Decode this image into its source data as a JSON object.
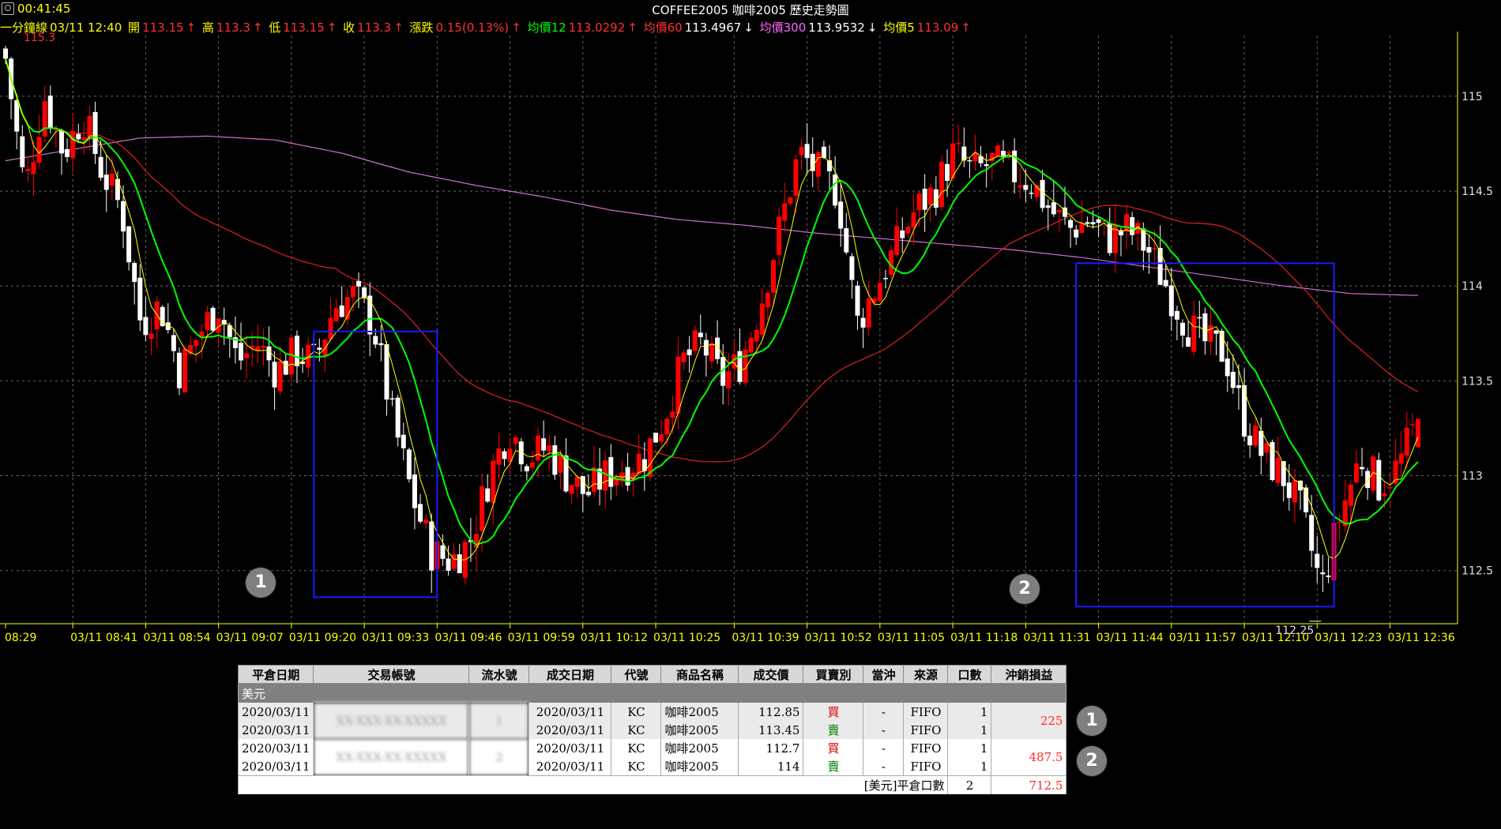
{
  "clock": "00:41:45",
  "title": "COFFEE2005 咖啡2005  歷史走勢圖",
  "info": {
    "label_1min": "一分鐘線",
    "date_time": "03/11 12:40",
    "open_label": "開",
    "open_value": "113.15",
    "high_label": "高",
    "high_value": "113.3",
    "low_label": "低",
    "low_value": "113.15",
    "close_label": "收",
    "close_value": "113.3",
    "change_label": "漲跌",
    "change_value": "0.15(0.13%)",
    "ma12_label": "均價12",
    "ma12_value": "113.0292",
    "ma60_label": "均價60",
    "ma60_value": "113.4967",
    "ma300_label": "均價300",
    "ma300_value": "113.9532",
    "ma5_label": "均價5",
    "ma5_value": "113.09",
    "up_arrow": "↑",
    "down_arrow": "↓",
    "top_price_label": "115.3"
  },
  "colors": {
    "up_candle": "#ff0000",
    "down_candle": "#ffffff",
    "ma5": "#ffff00",
    "ma12": "#00ff00",
    "ma60": "#e02020",
    "ma300": "#d070d0",
    "box": "#1a1aff",
    "grid": "#666666"
  },
  "chart_data": {
    "type": "candlestick",
    "title": "COFFEE2005 咖啡2005  歷史走勢圖",
    "y_ticks": [
      "115",
      "114.5",
      "114",
      "113.5",
      "113",
      "112.5"
    ],
    "x_ticks": [
      "08:29",
      "03/11 08:41",
      "03/11 08:54",
      "03/11 09:07",
      "03/11 09:20",
      "03/11 09:33",
      "03/11 09:46",
      "03/11 09:59",
      "03/11 10:12",
      "03/11 10:25",
      "03/11 10:39",
      "03/11 10:52",
      "03/11 11:05",
      "03/11 11:18",
      "03/11 11:31",
      "03/11 11:44",
      "03/11 11:57",
      "03/11 12:10",
      "03/11 12:23",
      "03/11 12:36"
    ],
    "ylim": [
      112.22,
      115.32
    ],
    "grid": true,
    "low_annotation": "112.25",
    "close_path": [
      115.2,
      114.5,
      115.0,
      114.7,
      114.9,
      114.6,
      114.4,
      113.8,
      113.9,
      113.55,
      113.75,
      113.9,
      113.6,
      113.7,
      113.55,
      113.65,
      113.6,
      113.9,
      113.95,
      113.8,
      113.3,
      112.9,
      112.6,
      112.55,
      112.65,
      113.0,
      113.25,
      113.1,
      113.15,
      113.0,
      112.9,
      113.0,
      113.05,
      113.1,
      113.3,
      113.6,
      113.7,
      113.5,
      113.6,
      113.9,
      114.3,
      114.7,
      114.6,
      114.5,
      113.8,
      114.0,
      114.2,
      114.4,
      114.5,
      114.7,
      114.6,
      114.65,
      114.6,
      114.55,
      114.4,
      114.3,
      114.35,
      114.25,
      114.3,
      114.2,
      114.0,
      113.8,
      113.7,
      113.65,
      113.3,
      113.1,
      113.0,
      112.8,
      112.4,
      112.8,
      113.1,
      112.95,
      113.05,
      113.3
    ],
    "ma300_path": [
      114.66,
      114.72,
      114.78,
      114.79,
      114.77,
      114.7,
      114.6,
      114.53,
      114.47,
      114.4,
      114.35,
      114.32,
      114.28,
      114.25,
      114.22,
      114.19,
      114.15,
      114.1,
      114.05,
      114.0,
      113.96,
      113.95
    ],
    "boxes": [
      {
        "name": "1",
        "from": "03/11 09:24",
        "to": "03/11 09:46",
        "price_high": 113.76,
        "price_low": 112.36
      },
      {
        "name": "2",
        "from": "03/11 11:40",
        "to": "03/11 12:26",
        "price_high": 114.12,
        "price_low": 112.31
      }
    ]
  },
  "table": {
    "headers": [
      "平倉日期",
      "交易帳號",
      "流水號",
      "成交日期",
      "代號",
      "商品名稱",
      "成交價",
      "買賣別",
      "當沖",
      "來源",
      "口數",
      "沖銷損益"
    ],
    "group_label": "美元",
    "rows": [
      {
        "close_date": "2020/03/11",
        "account": "XX-XXX-XX-XXXXX",
        "serial": "1",
        "trade_date": "2020/03/11",
        "code": "KC",
        "name": "咖啡2005",
        "price": "112.85",
        "side": "買",
        "daytrade": "-",
        "source": "FIFO",
        "qty": "1"
      },
      {
        "close_date": "2020/03/11",
        "account": "",
        "serial": "",
        "trade_date": "2020/03/11",
        "code": "KC",
        "name": "咖啡2005",
        "price": "113.45",
        "side": "賣",
        "daytrade": "-",
        "source": "FIFO",
        "qty": "1"
      },
      {
        "close_date": "2020/03/11",
        "account": "XX-XXX-XX-XXXXX",
        "serial": "2",
        "trade_date": "2020/03/11",
        "code": "KC",
        "name": "咖啡2005",
        "price": "112.7",
        "side": "買",
        "daytrade": "-",
        "source": "FIFO",
        "qty": "1"
      },
      {
        "close_date": "2020/03/11",
        "account": "",
        "serial": "",
        "trade_date": "2020/03/11",
        "code": "KC",
        "name": "咖啡2005",
        "price": "114",
        "side": "賣",
        "daytrade": "-",
        "source": "FIFO",
        "qty": "1"
      }
    ],
    "pl_1": "225",
    "pl_2": "487.5",
    "total_label": "[美元]平倉口數",
    "total_qty": "2",
    "total_pl": "712.5"
  },
  "markers": [
    "1",
    "2",
    "1",
    "2"
  ]
}
